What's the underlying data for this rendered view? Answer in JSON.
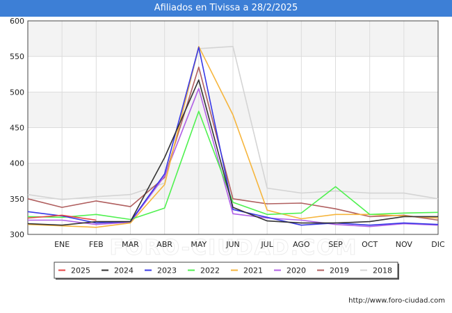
{
  "title": "Afiliados en Tivissa a 28/2/2025",
  "watermark": "FORO-CIUDAD.COM",
  "footer_url": "http://www.foro-ciudad.com",
  "chart_data": {
    "type": "line",
    "categories": [
      "",
      "ENE",
      "FEB",
      "MAR",
      "ABR",
      "MAY",
      "JUN",
      "JUL",
      "AGO",
      "SEP",
      "OCT",
      "NOV",
      "DIC"
    ],
    "ylim": [
      300,
      600
    ],
    "yticks": [
      300,
      350,
      400,
      450,
      500,
      550,
      600
    ],
    "grid": true,
    "legend_position": "bottom",
    "series": [
      {
        "name": "2018",
        "color": "#d4d4d4",
        "values": [
          356,
          349,
          353,
          356,
          372,
          561,
          564,
          365,
          358,
          361,
          358,
          358,
          350
        ]
      },
      {
        "name": "2019",
        "color": "#b05f5f",
        "values": [
          350,
          338,
          347,
          339,
          380,
          535,
          350,
          343,
          344,
          336,
          325,
          327,
          320
        ]
      },
      {
        "name": "2020",
        "color": "#b05fe6",
        "values": [
          320,
          320,
          314,
          317,
          382,
          505,
          329,
          323,
          320,
          314,
          311,
          315,
          313
        ]
      },
      {
        "name": "2021",
        "color": "#f6b53c",
        "values": [
          314,
          312,
          310,
          316,
          370,
          564,
          468,
          334,
          322,
          328,
          328,
          326,
          323
        ]
      },
      {
        "name": "2022",
        "color": "#4ff14f",
        "values": [
          325,
          324,
          328,
          321,
          337,
          473,
          345,
          328,
          330,
          367,
          328,
          330,
          331
        ]
      },
      {
        "name": "2023",
        "color": "#3838e6",
        "values": [
          332,
          326,
          316,
          318,
          385,
          563,
          335,
          324,
          313,
          316,
          313,
          316,
          314
        ]
      },
      {
        "name": "2024",
        "color": "#333333",
        "values": [
          315,
          313,
          318,
          318,
          408,
          517,
          338,
          319,
          316,
          316,
          318,
          325,
          325
        ]
      },
      {
        "name": "2025",
        "color": "#e64545",
        "values": [
          323,
          327,
          320,
          null,
          null,
          null,
          null,
          null,
          null,
          null,
          null,
          null,
          null
        ]
      }
    ],
    "legend_order": [
      "2025",
      "2024",
      "2023",
      "2022",
      "2021",
      "2020",
      "2019",
      "2018"
    ]
  }
}
